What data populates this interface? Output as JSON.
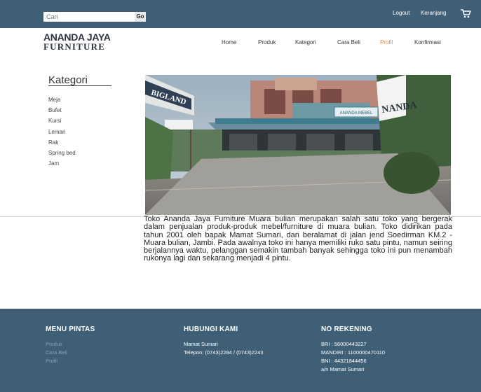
{
  "topbar": {
    "search_placeholder": "Cari",
    "search_button": "Go",
    "logout": "Logout",
    "cart": "Keranjang",
    "cart_icon": "shopping-cart-icon"
  },
  "logo": {
    "line1": "ANANDA JAYA",
    "line2": "FURNITURE"
  },
  "nav": {
    "items": [
      {
        "label": "Home"
      },
      {
        "label": "Produk"
      },
      {
        "label": "Kategori"
      },
      {
        "label": "Cara Beli"
      },
      {
        "label": "Profil"
      },
      {
        "label": "Konfirmasi"
      }
    ],
    "active": "Profil",
    "active_color": "#e8873b"
  },
  "sidebar": {
    "title": "Kategori",
    "items": [
      {
        "label": "Meja"
      },
      {
        "label": "Bufet"
      },
      {
        "label": "Kursi"
      },
      {
        "label": "Lemari"
      },
      {
        "label": "Rak"
      },
      {
        "label": "Spring bed"
      },
      {
        "label": "Jam"
      }
    ]
  },
  "photo": {
    "sign_left": "BIGLAND",
    "sign_store": "ANANDA MEBEL",
    "sign_right": "NANDA"
  },
  "description": "Toko Ananda Jaya Furniture Muara bulian merupakan salah satu toko yang bergerak dalam penjualan produk-produk mebel/furniture di muara bulian. Toko didirikan pada tahun 2001 oleh bapak Mamat Sumari, dan beralamat di jalan jend Soedirman KM.2 - Muara bulian, Jambi. Pada awalnya toko ini hanya memiliki ruko satu pintu, namun seiring berjalannya waktu, pelanggan semakin tambah banyak sehingga toko ini pun menambah rukonya lagi dan sekarang menjadi 4 pintu.",
  "footer": {
    "menu": {
      "heading": "MENU PINTAS",
      "links": [
        {
          "label": "Produk"
        },
        {
          "label": "Cara Beli"
        },
        {
          "label": "Profil"
        }
      ]
    },
    "contact": {
      "heading": "HUBUNGI KAMI",
      "name": "Mamat Sumari",
      "phone": "Telepon: (0743)2284 / (0743)2243"
    },
    "bank": {
      "heading": "NO REKENING",
      "lines": [
        {
          "text": "BRI : 56000443227"
        },
        {
          "text": "MANDIRI : 1100000470110"
        },
        {
          "text": "BNI : 44321844456"
        },
        {
          "text": "a/n Mamat Sumari"
        }
      ]
    }
  },
  "colors": {
    "topbar_bg": "#3e5f75",
    "footer_bg": "#3e5f75",
    "accent": "#e8873b"
  }
}
